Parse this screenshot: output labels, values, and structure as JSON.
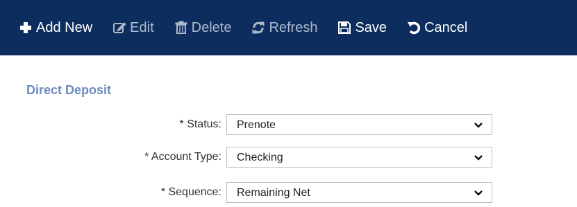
{
  "toolbar": {
    "add_new": "Add New",
    "edit": "Edit",
    "delete": "Delete",
    "refresh": "Refresh",
    "save": "Save",
    "cancel": "Cancel"
  },
  "section": {
    "title": "Direct Deposit"
  },
  "form": {
    "status": {
      "label": "* Status:",
      "value": "Prenote"
    },
    "account_type": {
      "label": "* Account Type:",
      "value": "Checking"
    },
    "sequence": {
      "label": "* Sequence:",
      "value": "Remaining Net"
    }
  },
  "colors": {
    "toolbar_bg": "#0c2d5e",
    "toolbar_text": "#ffffff",
    "toolbar_disabled_text": "#aeb9cc",
    "section_title": "#6b8bbf"
  }
}
